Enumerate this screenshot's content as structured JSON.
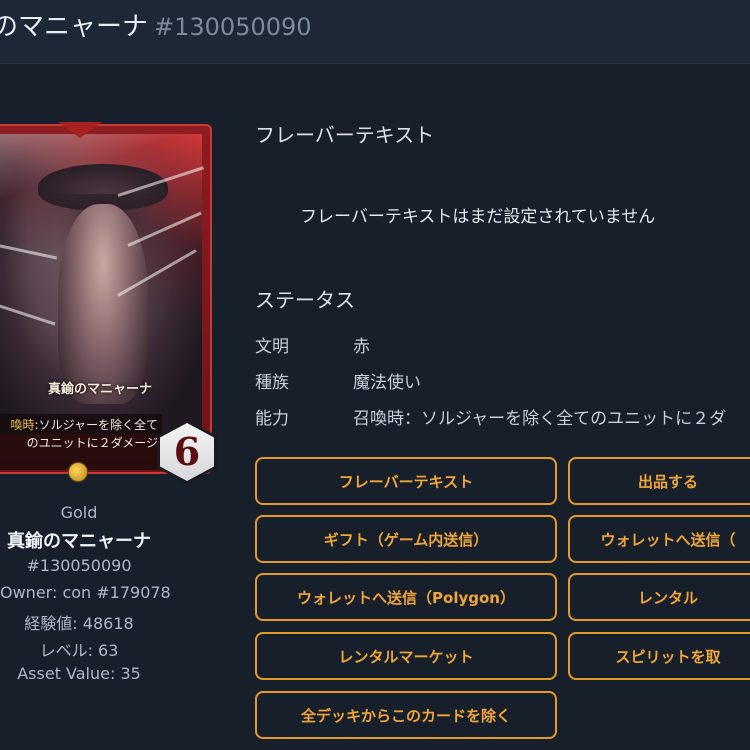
{
  "header": {
    "title": "のマニャーナ",
    "id": "#130050090"
  },
  "card": {
    "name": "真鍮のマニャーナ",
    "text_keyword": "喚時",
    "text_line1": ":ソルジャーを除く全て",
    "text_line2": "のユニットに２ダメージ",
    "cost": "6",
    "frame_color": "#c83a36"
  },
  "info": {
    "rarity": "Gold",
    "name": "真鍮のマニャーナ",
    "number": "#130050090",
    "owner": "Owner: con #179078",
    "exp": "経験値: 48618",
    "level": "レベル: 63",
    "asset_value": "Asset Value: 35"
  },
  "flavor": {
    "heading": "フレーバーテキスト",
    "empty_message": "フレーバーテキストはまだ設定されていません"
  },
  "status": {
    "heading": "ステータス",
    "rows": [
      {
        "key": "文明",
        "value": "赤"
      },
      {
        "key": "種族",
        "value": "魔法使い"
      },
      {
        "key": "能力",
        "value": "召喚時：ソルジャーを除く全てのユニットに２ダ"
      }
    ]
  },
  "actions": {
    "flavor_text": "フレーバーテキスト",
    "list_for_sale": "出品する",
    "gift_ingame": "ギフト（ゲーム内送信）",
    "send_wallet_cut": "ウォレットへ送信（",
    "send_wallet_polygon": "ウォレットへ送信（Polygon）",
    "rental": "レンタル",
    "rental_market": "レンタルマーケット",
    "spirit_take": "スピリットを取",
    "remove_from_decks": "全デッキからこのカードを除く"
  },
  "colors": {
    "background": "#171f2b",
    "accent": "#e39a2c"
  }
}
